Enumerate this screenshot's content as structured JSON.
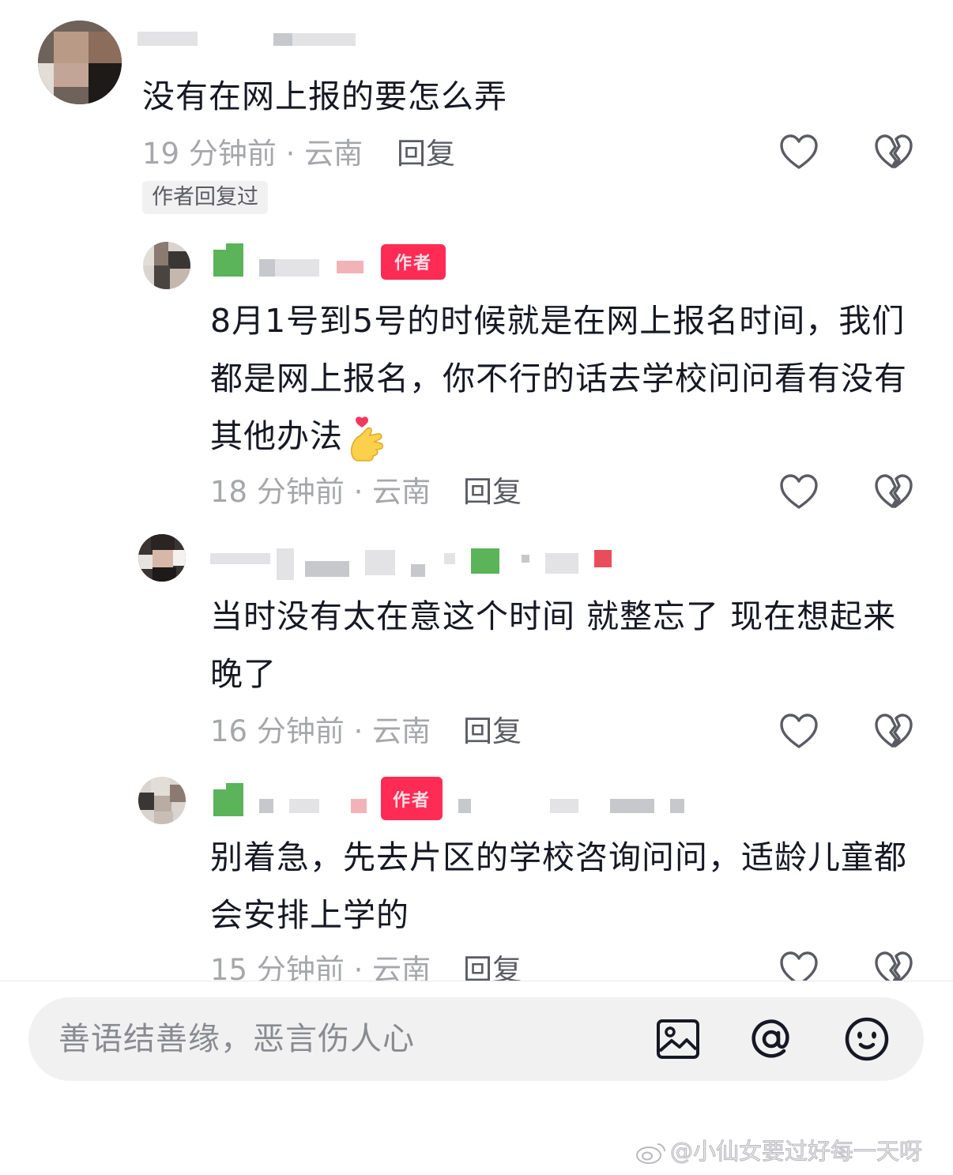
{
  "comments": [
    {
      "text": "没有在网上报的要怎么弄",
      "time_location": "19 分钟前 · 云南",
      "reply_label": "回复",
      "author_replied_tag": "作者回复过"
    },
    {
      "text": "8月1号到5号的时候就是在网上报名时间，我们都是网上报名，你不行的话去学校问问看有没有其他办法",
      "author_badge": "作者",
      "emoji": "heart-hands-emoji",
      "time_location": "18 分钟前 · 云南",
      "reply_label": "回复"
    },
    {
      "text": "当时没有太在意这个时间 就整忘了 现在想起来晚了",
      "time_location": "16 分钟前 · 云南",
      "reply_label": "回复"
    },
    {
      "text": "别着急，先去片区的学校咨询问问，适龄儿童都会安排上学的",
      "author_badge": "作者",
      "time_location": "15 分钟前 · 云南",
      "reply_label": "回复"
    }
  ],
  "icons": {
    "like": "heart-outline-icon",
    "dislike": "broken-heart-icon",
    "image": "image-icon",
    "mention": "at-icon",
    "emoji": "smiley-icon"
  },
  "input": {
    "placeholder": "善语结善缘，恶言伤人心"
  },
  "watermark": {
    "text": "@小仙女要过好每一天呀"
  },
  "colors": {
    "text": "#161823",
    "meta": "#a6a7ab",
    "author_badge": "#fe2c55",
    "input_bg": "#f1f1f2"
  }
}
